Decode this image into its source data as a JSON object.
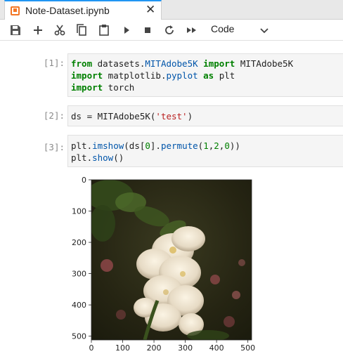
{
  "tab": {
    "title": "Note-Dataset.ipynb",
    "close_glyph": "✕",
    "icon": "notebook-icon"
  },
  "toolbar": {
    "buttons": [
      "save-icon",
      "plus-icon",
      "scissors-icon",
      "copy-icon",
      "paste-icon",
      "run-icon",
      "stop-icon",
      "restart-icon",
      "fast-forward-icon"
    ],
    "cell_type": "Code"
  },
  "cells": [
    {
      "prompt": "[1]:",
      "lines": [
        [
          {
            "t": "from",
            "c": "kw"
          },
          {
            "t": " datasets.",
            "c": ""
          },
          {
            "t": "MITAdobe5K",
            "c": "mod"
          },
          {
            "t": " ",
            "c": ""
          },
          {
            "t": "import",
            "c": "kw"
          },
          {
            "t": " MITAdobe5K",
            "c": ""
          }
        ],
        [
          {
            "t": "import",
            "c": "kw"
          },
          {
            "t": " matplotlib.",
            "c": ""
          },
          {
            "t": "pyplot",
            "c": "mod"
          },
          {
            "t": " ",
            "c": ""
          },
          {
            "t": "as",
            "c": "kw"
          },
          {
            "t": " plt",
            "c": ""
          }
        ],
        [
          {
            "t": "import",
            "c": "kw"
          },
          {
            "t": " torch",
            "c": ""
          }
        ]
      ]
    },
    {
      "prompt": "[2]:",
      "lines": [
        [
          {
            "t": "ds = MITAdobe5K(",
            "c": ""
          },
          {
            "t": "'test'",
            "c": "str"
          },
          {
            "t": ")",
            "c": ""
          }
        ]
      ]
    },
    {
      "prompt": "[3]:",
      "lines": [
        [
          {
            "t": "plt.",
            "c": ""
          },
          {
            "t": "imshow",
            "c": "mod"
          },
          {
            "t": "(ds[",
            "c": ""
          },
          {
            "t": "0",
            "c": "num"
          },
          {
            "t": "].",
            "c": ""
          },
          {
            "t": "permute",
            "c": "mod"
          },
          {
            "t": "(",
            "c": ""
          },
          {
            "t": "1",
            "c": "num"
          },
          {
            "t": ",",
            "c": ""
          },
          {
            "t": "2",
            "c": "num"
          },
          {
            "t": ",",
            "c": ""
          },
          {
            "t": "0",
            "c": "num"
          },
          {
            "t": "))",
            "c": ""
          }
        ],
        [
          {
            "t": "plt.",
            "c": ""
          },
          {
            "t": "show",
            "c": "mod"
          },
          {
            "t": "()",
            "c": ""
          }
        ]
      ]
    }
  ],
  "chart_data": {
    "type": "image",
    "xticks": [
      0,
      100,
      200,
      300,
      400,
      500
    ],
    "yticks": [
      0,
      100,
      200,
      300,
      400,
      500
    ],
    "xlim": [
      0,
      512
    ],
    "ylim": [
      512,
      0
    ],
    "image_description_colors": {
      "background": "#2b2a17",
      "flower": "#e8dcc8",
      "leaf": "#3f5a22"
    }
  }
}
